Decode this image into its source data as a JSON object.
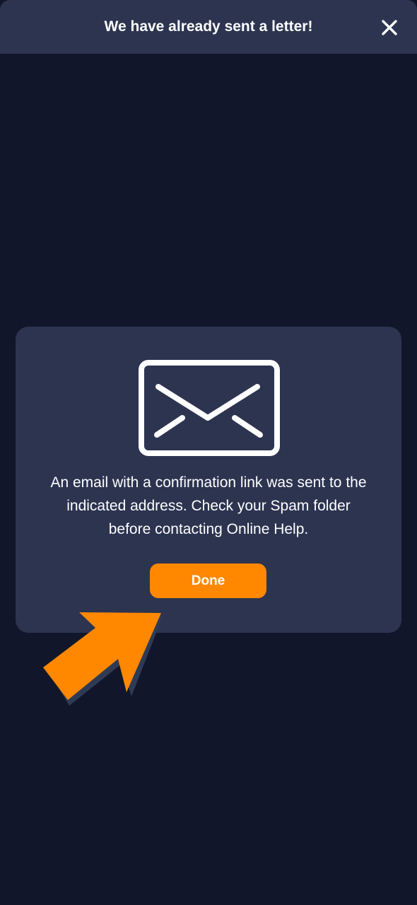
{
  "header": {
    "title": "We have already sent a letter!",
    "close_icon": "close-icon"
  },
  "dialog": {
    "icon": "envelope-icon",
    "message": "An email with a confirmation link was sent to the indicated address. Check your Spam folder before contacting Online Help.",
    "done_label": "Done"
  },
  "decoration": {
    "pointer_icon": "pointer-arrow-icon"
  },
  "colors": {
    "background": "#11162b",
    "surface": "#2c3450",
    "accent": "#ff8800",
    "text": "#ffffff"
  }
}
